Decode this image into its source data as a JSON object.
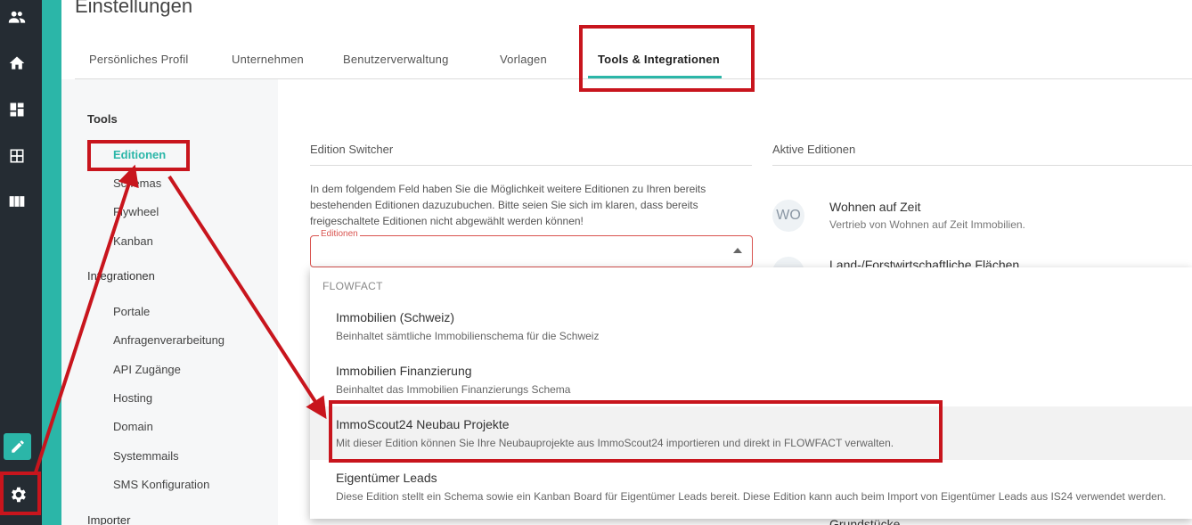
{
  "page": {
    "title": "Einstellungen"
  },
  "tabs": [
    {
      "label": "Persönliches Profil"
    },
    {
      "label": "Unternehmen"
    },
    {
      "label": "Benutzerverwaltung"
    },
    {
      "label": "Vorlagen"
    },
    {
      "label": "Tools & Integrationen",
      "active": true
    }
  ],
  "nav": {
    "icons": [
      "users-icon",
      "home-icon",
      "dashboard-icon",
      "grid-icon",
      "columns-icon",
      "edit-icon",
      "gear-icon"
    ]
  },
  "sidebar": {
    "tools_heading": "Tools",
    "tools_items": [
      {
        "label": "Editionen",
        "active": true
      },
      {
        "label": "Schemas"
      },
      {
        "label": "Flywheel"
      },
      {
        "label": "Kanban"
      }
    ],
    "integrations_heading": "Integrationen",
    "integration_items": [
      {
        "label": "Portale"
      },
      {
        "label": "Anfragenverarbeitung"
      },
      {
        "label": "API Zugänge"
      },
      {
        "label": "Hosting"
      },
      {
        "label": "Domain"
      },
      {
        "label": "Systemmails"
      },
      {
        "label": "SMS Konfiguration"
      }
    ],
    "importer_heading": "Importer"
  },
  "switcher": {
    "heading": "Edition Switcher",
    "description": "In dem folgendem Feld haben Sie die Möglichkeit weitere Editionen zu Ihren bereits bestehenden Editionen dazuzubuchen. Bitte seien Sie sich im klaren, dass bereits freigeschaltete Editionen nicht abgewählt werden können!",
    "field_label": "Editionen",
    "field_value": ""
  },
  "active_editions": {
    "heading": "Aktive Editionen",
    "items": [
      {
        "avatar": "WO",
        "title": "Wohnen auf Zeit",
        "subtitle": "Vertrieb von Wohnen auf Zeit Immobilien."
      },
      {
        "avatar": "",
        "title": "Land-/Forstwirtschaftliche Flächen",
        "subtitle": ""
      },
      {
        "avatar": "",
        "title": "Grundstücke",
        "subtitle": ""
      }
    ]
  },
  "dropdown": {
    "group": "FLOWFACT",
    "options": [
      {
        "title": "Immobilien (Schweiz)",
        "subtitle": "Beinhaltet sämtliche Immobilienschema für die Schweiz"
      },
      {
        "title": "Immobilien Finanzierung",
        "subtitle": "Beinhaltet das Immobilien Finanzierungs Schema"
      },
      {
        "title": "ImmoScout24 Neubau Projekte",
        "subtitle": "Mit dieser Edition können Sie Ihre Neubauprojekte aus ImmoScout24 importieren und direkt in FLOWFACT verwalten.",
        "highlighted": true
      },
      {
        "title": "Eigentümer Leads",
        "subtitle": "Diese Edition stellt ein Schema sowie ein Kanban Board für Eigentümer Leads bereit. Diese Edition kann auch beim Import von Eigentümer Leads aus IS24 verwendet werden."
      }
    ]
  },
  "colors": {
    "accent": "#2bb6a8",
    "nav_bg": "#252c33",
    "annotation": "#c8151d",
    "error": "#d9534f"
  }
}
